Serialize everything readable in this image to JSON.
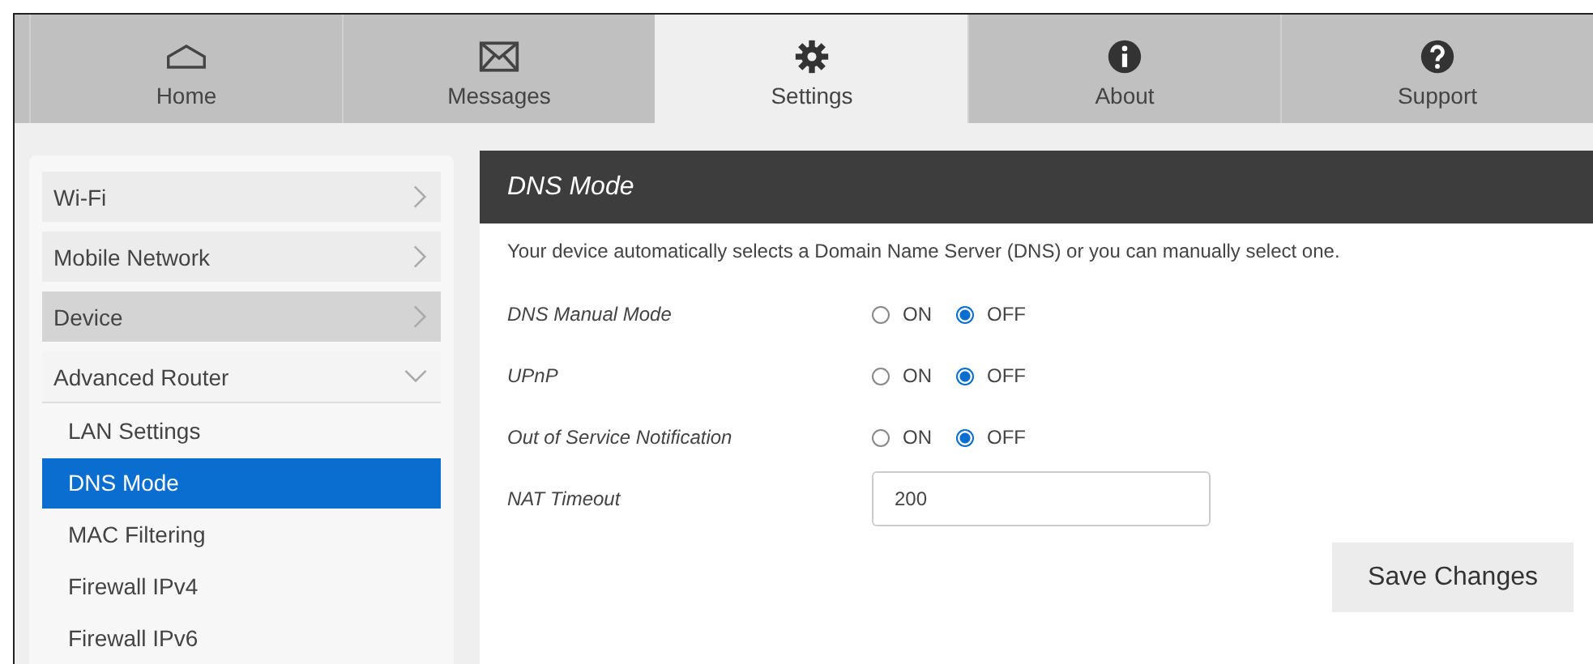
{
  "tabs": [
    {
      "label": "Home",
      "selected": false
    },
    {
      "label": "Messages",
      "selected": false
    },
    {
      "label": "Settings",
      "selected": true
    },
    {
      "label": "About",
      "selected": false
    },
    {
      "label": "Support",
      "selected": false
    }
  ],
  "sidebar": {
    "items": [
      {
        "label": "Wi-Fi",
        "highlighted": false,
        "expanded": false
      },
      {
        "label": "Mobile Network",
        "highlighted": false,
        "expanded": false
      },
      {
        "label": "Device",
        "highlighted": true,
        "expanded": false
      },
      {
        "label": "Advanced Router",
        "highlighted": false,
        "expanded": true,
        "children": [
          {
            "label": "LAN Settings",
            "selected": false
          },
          {
            "label": "DNS Mode",
            "selected": true
          },
          {
            "label": "MAC Filtering",
            "selected": false
          },
          {
            "label": "Firewall IPv4",
            "selected": false
          },
          {
            "label": "Firewall IPv6",
            "selected": false
          }
        ]
      }
    ]
  },
  "panel": {
    "title": "DNS Mode",
    "description": "Your device automatically selects a Domain Name Server (DNS) or you can manually select one.",
    "settings": [
      {
        "kind": "radio",
        "label": "DNS Manual Mode",
        "options": [
          {
            "label": "ON",
            "selected": false
          },
          {
            "label": "OFF",
            "selected": true
          }
        ]
      },
      {
        "kind": "radio",
        "label": "UPnP",
        "options": [
          {
            "label": "ON",
            "selected": false
          },
          {
            "label": "OFF",
            "selected": true
          }
        ]
      },
      {
        "kind": "radio",
        "label": "Out of Service Notification",
        "options": [
          {
            "label": "ON",
            "selected": false
          },
          {
            "label": "OFF",
            "selected": true
          }
        ]
      },
      {
        "kind": "text",
        "label": "NAT Timeout",
        "value": "200"
      }
    ],
    "save_button": "Save Changes"
  }
}
